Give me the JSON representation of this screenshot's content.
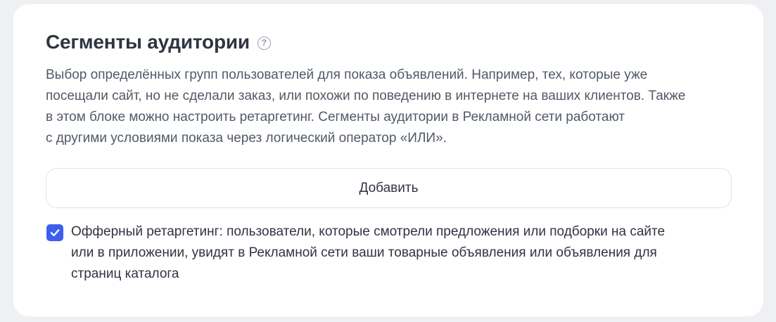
{
  "section": {
    "title": "Сегменты аудитории",
    "help_icon": "question-circle-icon",
    "description_lines": [
      "Выбор определённых групп пользователей для показа объявлений. Например, тех, которые уже",
      "посещали сайт, но не сделали заказ, или похожи по поведению в интернете на ваших клиентов. Также",
      "в этом блоке можно настроить ретаргетинг. Сегменты аудитории в Рекламной сети работают",
      "с другими условиями показа через логический оператор «ИЛИ»."
    ],
    "add_button_label": "Добавить",
    "offer_retargeting": {
      "checked": true,
      "label_lines": [
        "Офферный ретаргетинг: пользователи, которые смотрели предложения или подборки на сайте",
        "или в приложении, увидят в Рекламной сети ваши товарные объявления или объявления для",
        "страниц каталога"
      ]
    }
  },
  "colors": {
    "accent": "#3d5ff0",
    "background": "#eef0f3",
    "card": "#ffffff"
  }
}
